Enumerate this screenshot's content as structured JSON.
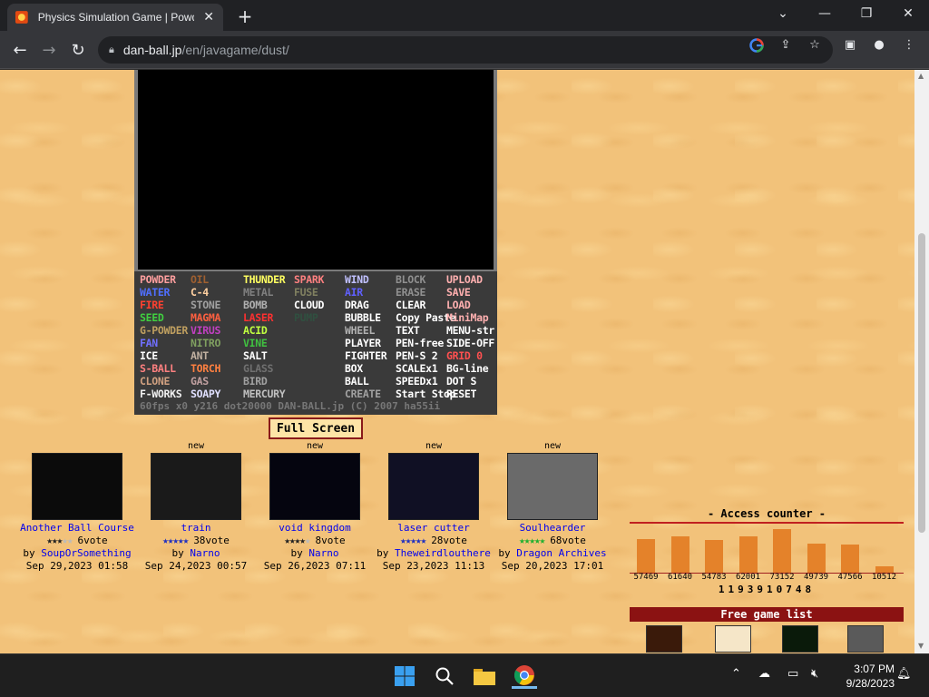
{
  "browser": {
    "tab_title": "Physics Simulation Game | Powder Game",
    "tab_close": "✕",
    "new_tab": "+",
    "url_domain": "dan-ball.jp",
    "url_path": "/en/javagame/dust/",
    "min": "—",
    "restore": "❐",
    "close": "✕",
    "dropdown": "⌄"
  },
  "game": {
    "status_line": "60fps x0   y216  dot20000  DAN-BALL.jp (C) 2007 ha55ii",
    "fullscreen_label": "Full Screen",
    "panel_col1": [
      "POWDER",
      "WATER",
      "FIRE",
      "SEED",
      "G-POWDER",
      "FAN",
      "ICE",
      "S-BALL",
      "CLONE",
      "F-WORKS"
    ],
    "panel_col2": [
      "OIL",
      "C-4",
      "STONE",
      "MAGMA",
      "VIRUS",
      "NITRO",
      "ANT",
      "TORCH",
      "GAS",
      "SOAPY"
    ],
    "panel_col3": [
      "THUNDER",
      "METAL",
      "BOMB",
      "LASER",
      "ACID",
      "VINE",
      "SALT",
      "GLASS",
      "BIRD",
      "MERCURY"
    ],
    "panel_col4": [
      "SPARK",
      "FUSE",
      "CLOUD",
      "PUMP"
    ],
    "panel_col5": [
      "WIND",
      "AIR",
      "DRAG",
      "BUBBLE",
      "WHEEL",
      "PLAYER",
      "FIGHTER",
      "BOX",
      "BALL",
      "CREATE"
    ],
    "panel_col6": [
      "BLOCK",
      "ERASE",
      "CLEAR",
      "Copy Paste",
      "TEXT",
      "PEN-free",
      "PEN-S 2",
      "SCALEx1",
      "SPEEDx1",
      "Start Stop"
    ],
    "panel_col7": [
      "UPLOAD",
      "SAVE",
      "LOAD",
      "MiniMap",
      "MENU-str",
      "SIDE-OFF",
      "GRID 0",
      "BG-line",
      "DOT S",
      "RESET"
    ]
  },
  "uploads": [
    {
      "new": "",
      "title": "Another Ball Course",
      "votes": "6vote",
      "stars_on": 3,
      "star_color": "#222",
      "by": "by",
      "author": "SoupOrSomething",
      "date": "Sep 29,2023 01:58"
    },
    {
      "new": "new",
      "title": "train",
      "votes": "38vote",
      "stars_on": 5,
      "star_color": "#2030c0",
      "by": "by",
      "author": "Narno",
      "date": "Sep 24,2023 00:57"
    },
    {
      "new": "new",
      "title": "void kingdom",
      "votes": "8vote",
      "stars_on": 4,
      "star_color": "#222",
      "by": "by",
      "author": "Narno",
      "date": "Sep 26,2023 07:11"
    },
    {
      "new": "new",
      "title": "laser cutter",
      "votes": "28vote",
      "stars_on": 5,
      "star_color": "#2030c0",
      "by": "by",
      "author": "Theweirdlouthere",
      "date": "Sep 23,2023 11:13"
    },
    {
      "new": "new",
      "title": "Soulhearder",
      "votes": "68vote",
      "stars_on": 5,
      "star_color": "#20b030",
      "by": "by",
      "author": "Dragon Archives",
      "date": "Sep 20,2023 17:01"
    }
  ],
  "counter": {
    "title": "- Access counter -",
    "values": [
      57469,
      61640,
      54783,
      62001,
      73152,
      49739,
      47566,
      10512
    ],
    "labels": [
      "57469",
      "61640",
      "54783",
      "62001",
      "73152",
      "49739",
      "47566",
      "10512"
    ],
    "total": "1193910748"
  },
  "free_games": {
    "title": "Free game list"
  },
  "taskbar": {
    "time": "3:07 PM",
    "date": "9/28/2023"
  }
}
